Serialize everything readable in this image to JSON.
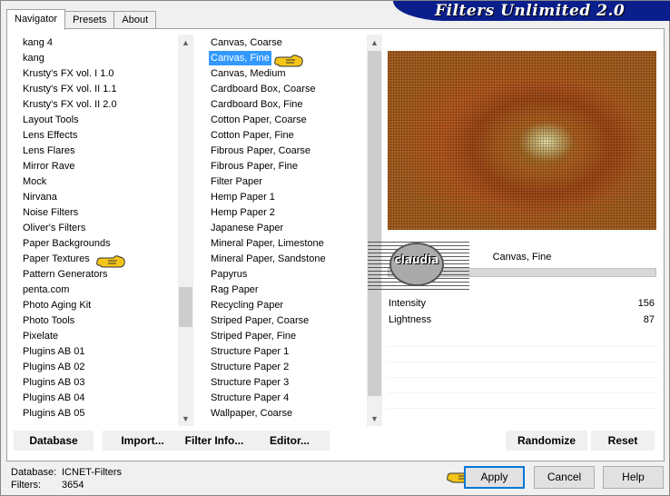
{
  "window": {
    "title": "Filters Unlimited 2.0"
  },
  "tabs": [
    {
      "label": "Navigator",
      "active": true
    },
    {
      "label": "Presets",
      "active": false
    },
    {
      "label": "About",
      "active": false
    }
  ],
  "categories": {
    "items": [
      "kang 4",
      "kang",
      "Krusty's FX vol. I 1.0",
      "Krusty's FX vol. II 1.1",
      "Krusty's FX vol. II 2.0",
      "Layout Tools",
      "Lens Effects",
      "Lens Flares",
      "Mirror Rave",
      "Mock",
      "Nirvana",
      "Noise Filters",
      "Oliver's Filters",
      "Paper Backgrounds",
      "Paper Textures",
      "Pattern Generators",
      "penta.com",
      "Photo Aging Kit",
      "Photo Tools",
      "Pixelate",
      "Plugins AB 01",
      "Plugins AB 02",
      "Plugins AB 03",
      "Plugins AB 04",
      "Plugins AB 05"
    ],
    "selected": "Paper Textures"
  },
  "filters": {
    "items": [
      "Canvas, Coarse",
      "Canvas, Fine",
      "Canvas, Medium",
      "Cardboard Box, Coarse",
      "Cardboard Box, Fine",
      "Cotton Paper, Coarse",
      "Cotton Paper, Fine",
      "Fibrous Paper, Coarse",
      "Fibrous Paper, Fine",
      "Filter Paper",
      "Hemp Paper 1",
      "Hemp Paper 2",
      "Japanese Paper",
      "Mineral Paper, Limestone",
      "Mineral Paper, Sandstone",
      "Papyrus",
      "Rag Paper",
      "Recycling Paper",
      "Striped Paper, Coarse",
      "Striped Paper, Fine",
      "Structure Paper 1",
      "Structure Paper 2",
      "Structure Paper 3",
      "Structure Paper 4",
      "Wallpaper, Coarse"
    ],
    "selected": "Canvas, Fine"
  },
  "preview": {
    "filter_name": "Canvas, Fine",
    "watermark": "claudia"
  },
  "parameters": [
    {
      "label": "Intensity",
      "value": "156"
    },
    {
      "label": "Lightness",
      "value": "87"
    }
  ],
  "toolbar": {
    "database": "Database",
    "import": "Import...",
    "filter_info": "Filter Info...",
    "editor": "Editor...",
    "randomize": "Randomize",
    "reset": "Reset"
  },
  "footer": {
    "database_label": "Database:",
    "database_value": "ICNET-Filters",
    "filters_label": "Filters:",
    "filters_value": "3654"
  },
  "buttons": {
    "apply": "Apply",
    "cancel": "Cancel",
    "help": "Help"
  },
  "colors": {
    "banner": "#0a1e8c",
    "selection": "#3399ff",
    "pointer_hand": "#f5c518"
  }
}
